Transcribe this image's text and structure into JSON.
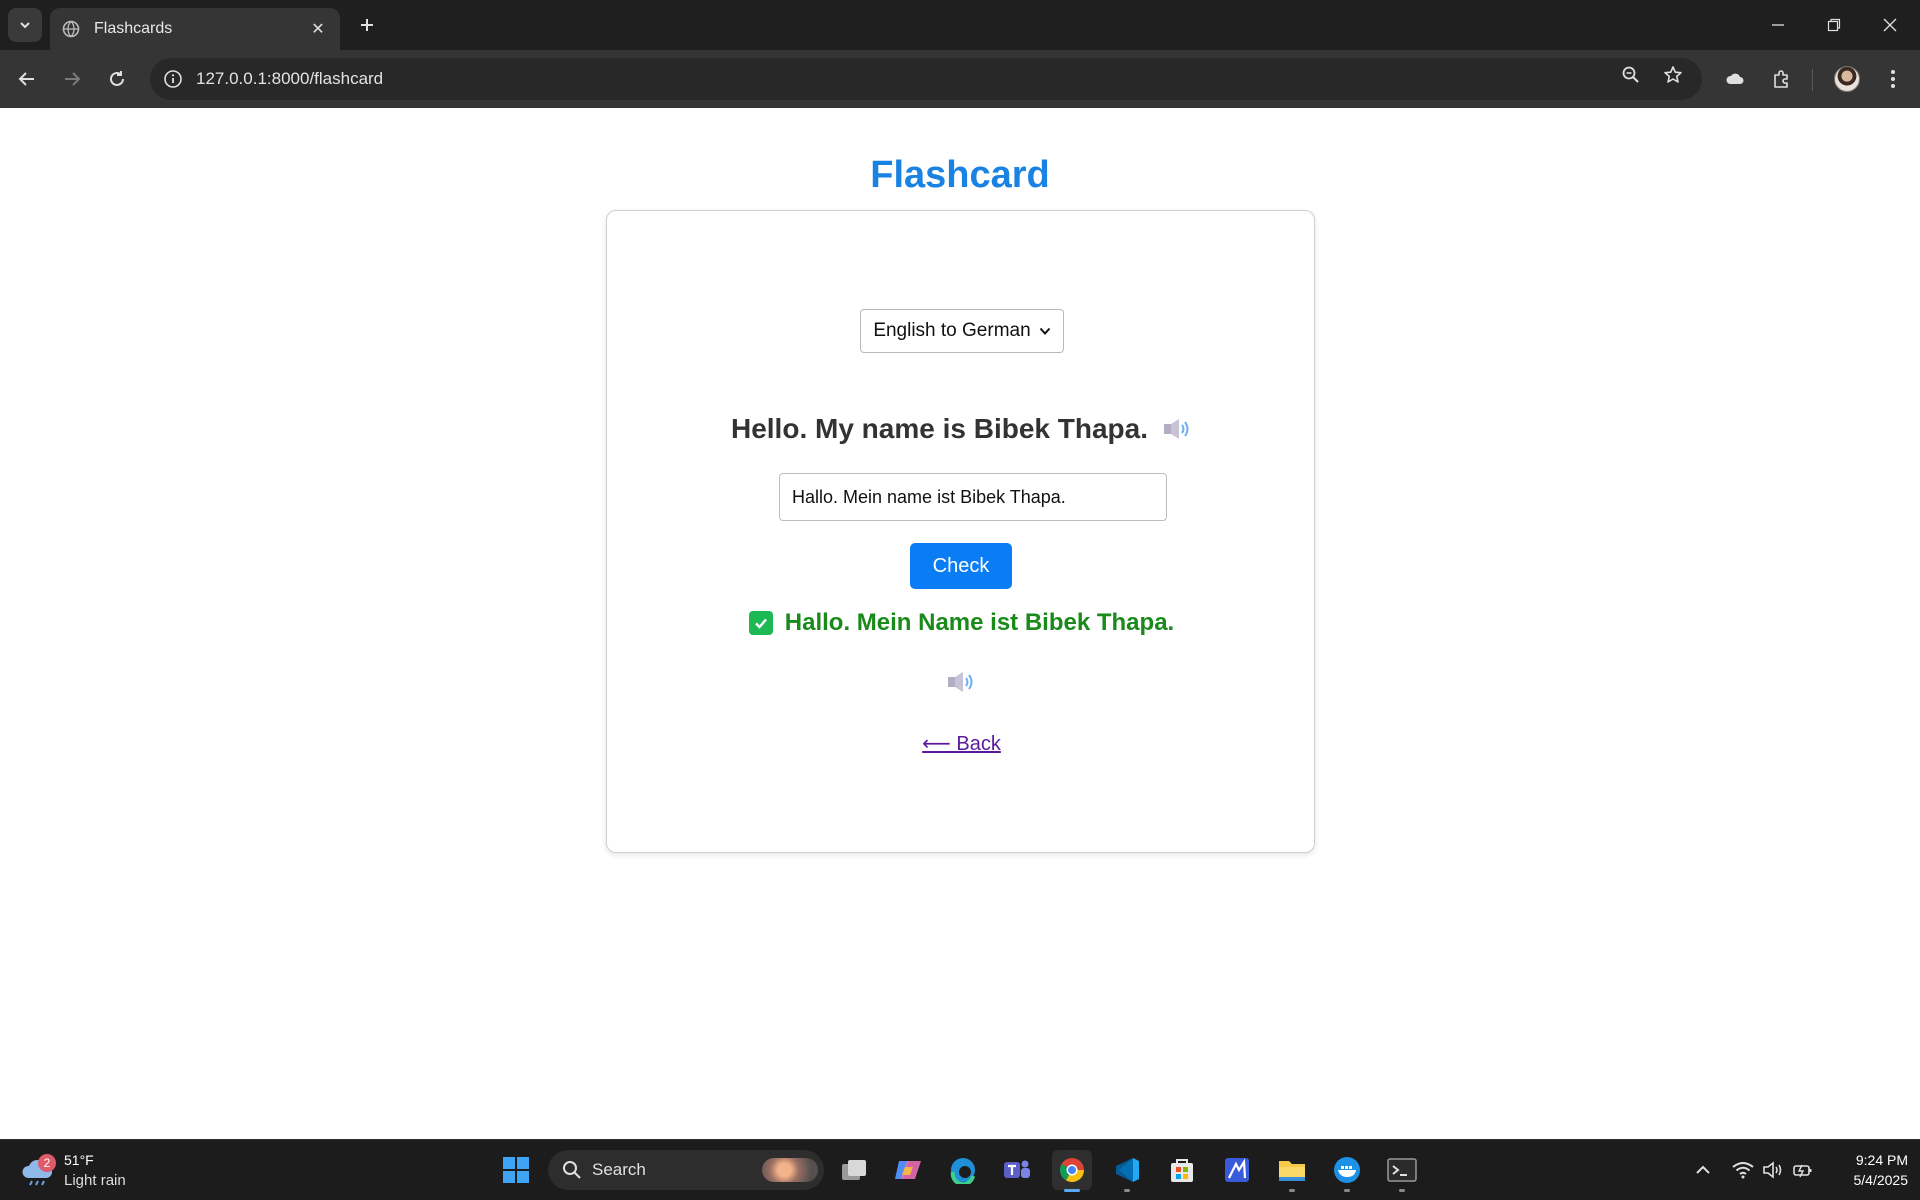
{
  "browser": {
    "tab_title": "Flashcards",
    "url": "127.0.0.1:8000/flashcard"
  },
  "page": {
    "title": "Flashcard",
    "mode_select": {
      "selected": "English to German"
    },
    "question": "Hello. My name is Bibek Thapa.",
    "answer_value": "Hallo. Mein name ist Bibek Thapa.",
    "check_label": "Check",
    "result_text": "Hallo. Mein Name ist Bibek Thapa.",
    "back_label": "⟵ Back"
  },
  "taskbar": {
    "weather_temp": "51°F",
    "weather_condition": "Light rain",
    "weather_badge": "2",
    "search_label": "Search",
    "time": "9:24 PM",
    "date": "5/4/2025"
  },
  "colors": {
    "title_blue": "#1a82e2",
    "button_blue": "#0a7df5",
    "success_green": "#1a8a1a",
    "link_purple": "#5a1a9a"
  }
}
